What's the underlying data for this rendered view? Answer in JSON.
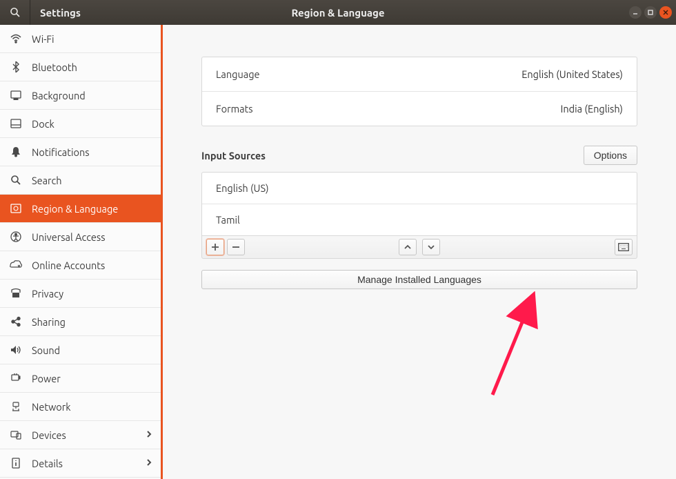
{
  "header": {
    "app_title": "Settings",
    "page_title": "Region & Language"
  },
  "sidebar": {
    "items": [
      {
        "id": "wifi",
        "label": "Wi-Fi"
      },
      {
        "id": "bluetooth",
        "label": "Bluetooth"
      },
      {
        "id": "background",
        "label": "Background"
      },
      {
        "id": "dock",
        "label": "Dock"
      },
      {
        "id": "notifications",
        "label": "Notifications"
      },
      {
        "id": "search",
        "label": "Search"
      },
      {
        "id": "region-language",
        "label": "Region & Language"
      },
      {
        "id": "universal-access",
        "label": "Universal Access"
      },
      {
        "id": "online-accounts",
        "label": "Online Accounts"
      },
      {
        "id": "privacy",
        "label": "Privacy"
      },
      {
        "id": "sharing",
        "label": "Sharing"
      },
      {
        "id": "sound",
        "label": "Sound"
      },
      {
        "id": "power",
        "label": "Power"
      },
      {
        "id": "network",
        "label": "Network"
      },
      {
        "id": "devices",
        "label": "Devices"
      },
      {
        "id": "details",
        "label": "Details"
      }
    ]
  },
  "main": {
    "language_label": "Language",
    "language_value": "English (United States)",
    "formats_label": "Formats",
    "formats_value": "India (English)",
    "input_sources_title": "Input Sources",
    "options_button": "Options",
    "input_sources": [
      "English (US)",
      "Tamil"
    ],
    "manage_button": "Manage Installed Languages"
  }
}
